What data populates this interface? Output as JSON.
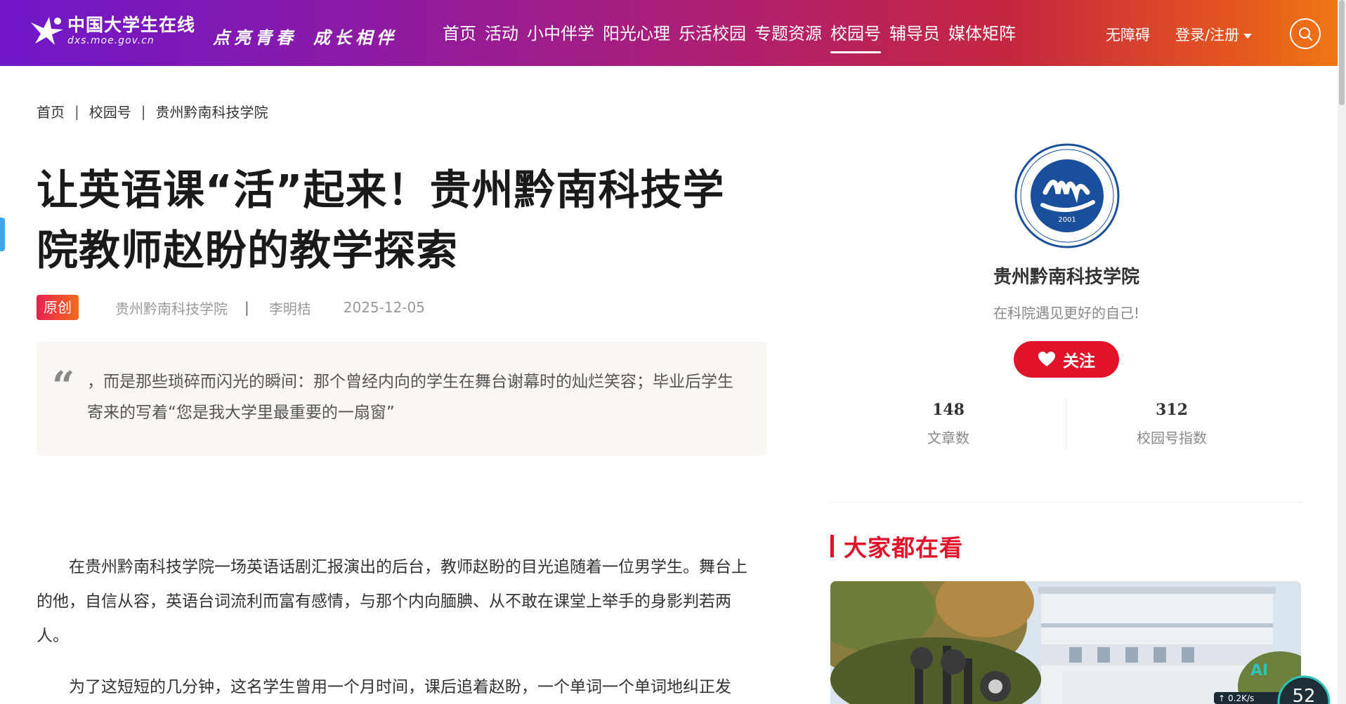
{
  "header": {
    "logo_cn": "中国大学生在线",
    "logo_url": "dxs.moe.gov.cn",
    "slogan_1": "点亮青春",
    "slogan_2": "成长相伴",
    "nav": [
      {
        "label": "首页"
      },
      {
        "label": "活动"
      },
      {
        "label": "小中伴学"
      },
      {
        "label": "阳光心理"
      },
      {
        "label": "乐活校园"
      },
      {
        "label": "专题资源"
      },
      {
        "label": "校园号",
        "active": true
      },
      {
        "label": "辅导员"
      },
      {
        "label": "媒体矩阵"
      }
    ],
    "accessibility": "无障碍",
    "login": "登录/注册"
  },
  "breadcrumb": {
    "home": "首页",
    "section": "校园号",
    "current": "贵州黔南科技学院"
  },
  "article": {
    "title": "让英语课“活”起来！贵州黔南科技学院教师赵盼的教学探索",
    "badge": "原创",
    "source": "贵州黔南科技学院",
    "separator": "|",
    "author": "李明桔",
    "date": "2025-12-05",
    "quote_mark": "“",
    "quote": "，而是那些琐碎而闪光的瞬间：那个曾经内向的学生在舞台谢幕时的灿烂笑容；毕业后学生寄来的写着“您是我大学里最重要的一扇窗”",
    "paragraphs": [
      "在贵州黔南科技学院一场英语话剧汇报演出的后台，教师赵盼的目光追随着一位男学生。舞台上的他，自信从容，英语台词流利而富有感情，与那个内向腼腆、从不敢在课堂上举手的身影判若两人。",
      "为了这短短的几分钟，这名学生曾用一个月时间，课后追着赵盼，一个单词一个单词地纠正发"
    ]
  },
  "sidebar": {
    "school_name": "贵州黔南科技学院",
    "motto": "在科院遇见更好的自己!",
    "follow": "关注",
    "stats": [
      {
        "value": "148",
        "label": "文章数"
      },
      {
        "value": "312",
        "label": "校园号指数"
      }
    ],
    "logo_year": "2001",
    "section_title": "大家都在看"
  },
  "widget": {
    "ai": "AI",
    "speed": "0.2K/s",
    "num": "52"
  },
  "colors": {
    "accent": "#e0132a",
    "header_start": "#6f17c9",
    "header_end": "#ef7a12",
    "quote_bg": "#faf6f1"
  }
}
